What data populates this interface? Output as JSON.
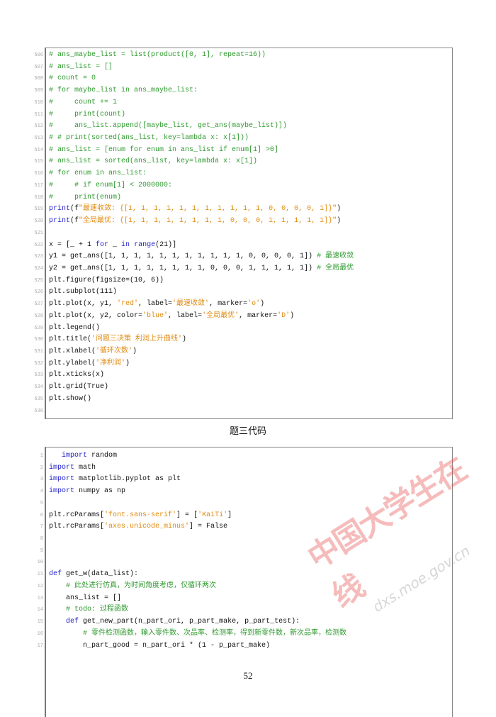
{
  "listing1": [
    {
      "n": "506",
      "t": [
        [
          "c",
          "# ans_maybe_list = list(product([0, 1], repeat=16))"
        ]
      ]
    },
    {
      "n": "507",
      "t": [
        [
          "c",
          "# ans_list = []"
        ]
      ]
    },
    {
      "n": "508",
      "t": [
        [
          "c",
          "# count = 0"
        ]
      ]
    },
    {
      "n": "509",
      "t": [
        [
          "c",
          "# for maybe_list in ans_maybe_list:"
        ]
      ]
    },
    {
      "n": "510",
      "t": [
        [
          "c",
          "#     count += 1"
        ]
      ]
    },
    {
      "n": "511",
      "t": [
        [
          "c",
          "#     print(count)"
        ]
      ]
    },
    {
      "n": "512",
      "t": [
        [
          "c",
          "#     ans_list.append([maybe_list, get_ans(maybe_list)])"
        ]
      ]
    },
    {
      "n": "513",
      "t": [
        [
          "c",
          "# # print(sorted(ans_list, key=lambda x: x[1]))"
        ]
      ]
    },
    {
      "n": "514",
      "t": [
        [
          "c",
          "# ans_list = [enum for enum in ans_list if enum[1] >0]"
        ]
      ]
    },
    {
      "n": "515",
      "t": [
        [
          "c",
          "# ans_list = sorted(ans_list, key=lambda x: x[1])"
        ]
      ]
    },
    {
      "n": "516",
      "t": [
        [
          "c",
          "# for enum in ans_list:"
        ]
      ]
    },
    {
      "n": "517",
      "t": [
        [
          "c",
          "#     # if enum[1] < 2000000:"
        ]
      ]
    },
    {
      "n": "518",
      "t": [
        [
          "c",
          "#     print(enum)"
        ]
      ]
    },
    {
      "n": "519",
      "t": [
        [
          "k",
          "print"
        ],
        [
          "p",
          "(f"
        ],
        [
          "s",
          "\"最速收敛: {[1, 1, 1, 1, 1, 1, 1, 1, 1, 1, 1, 0, 0, 0, 0, 1]}\""
        ],
        [
          "p",
          ")"
        ]
      ]
    },
    {
      "n": "520",
      "t": [
        [
          "k",
          "print"
        ],
        [
          "p",
          "(f"
        ],
        [
          "s",
          "\"全局最优: {[1, 1, 1, 1, 1, 1, 1, 1, 0, 0, 0, 1, 1, 1, 1, 1]}\""
        ],
        [
          "p",
          ")"
        ]
      ]
    },
    {
      "n": "521",
      "t": []
    },
    {
      "n": "522",
      "t": [
        [
          "p",
          "x = [_ + 1 "
        ],
        [
          "k",
          "for"
        ],
        [
          "p",
          " _ "
        ],
        [
          "k",
          "in"
        ],
        [
          "p",
          " "
        ],
        [
          "k",
          "range"
        ],
        [
          "p",
          "(21)]"
        ]
      ]
    },
    {
      "n": "523",
      "t": [
        [
          "p",
          "y1 = get_ans([1, 1, 1, 1, 1, 1, 1, 1, 1, 1, 1, 0, 0, 0, 0, 1]) "
        ],
        [
          "c",
          "# 最速收敛"
        ]
      ]
    },
    {
      "n": "524",
      "t": [
        [
          "p",
          "y2 = get_ans([1, 1, 1, 1, 1, 1, 1, 1, 0, 0, 0, 1, 1, 1, 1, 1]) "
        ],
        [
          "c",
          "# 全局最优"
        ]
      ]
    },
    {
      "n": "525",
      "t": [
        [
          "p",
          "plt.figure(figsize=(10, 6))"
        ]
      ]
    },
    {
      "n": "526",
      "t": [
        [
          "p",
          "plt.subplot(111)"
        ]
      ]
    },
    {
      "n": "527",
      "t": [
        [
          "p",
          "plt.plot(x, y1, "
        ],
        [
          "s",
          "'red'"
        ],
        [
          "p",
          ", label="
        ],
        [
          "s",
          "'最速收敛'"
        ],
        [
          "p",
          ", marker="
        ],
        [
          "s",
          "'o'"
        ],
        [
          "p",
          ")"
        ]
      ]
    },
    {
      "n": "528",
      "t": [
        [
          "p",
          "plt.plot(x, y2, color="
        ],
        [
          "s",
          "'blue'"
        ],
        [
          "p",
          ", label="
        ],
        [
          "s",
          "'全局最优'"
        ],
        [
          "p",
          ", marker="
        ],
        [
          "s",
          "'D'"
        ],
        [
          "p",
          ")"
        ]
      ]
    },
    {
      "n": "529",
      "t": [
        [
          "p",
          "plt.legend()"
        ]
      ]
    },
    {
      "n": "530",
      "t": [
        [
          "p",
          "plt.title("
        ],
        [
          "s",
          "'问题三决策 利润上升曲线'"
        ],
        [
          "p",
          ")"
        ]
      ]
    },
    {
      "n": "531",
      "t": [
        [
          "p",
          "plt.xlabel("
        ],
        [
          "s",
          "'循环次数'"
        ],
        [
          "p",
          ")"
        ]
      ]
    },
    {
      "n": "532",
      "t": [
        [
          "p",
          "plt.ylabel("
        ],
        [
          "s",
          "'净利润'"
        ],
        [
          "p",
          ")"
        ]
      ]
    },
    {
      "n": "533",
      "t": [
        [
          "p",
          "plt.xticks(x)"
        ]
      ]
    },
    {
      "n": "534",
      "t": [
        [
          "p",
          "plt.grid(True)"
        ]
      ]
    },
    {
      "n": "535",
      "t": [
        [
          "p",
          "plt.show()"
        ]
      ]
    },
    {
      "n": "536",
      "t": []
    }
  ],
  "caption": "题三代码",
  "listing2": [
    {
      "n": "1",
      "t": [
        [
          "p",
          "   "
        ],
        [
          "k",
          "import"
        ],
        [
          "p",
          " random"
        ]
      ]
    },
    {
      "n": "2",
      "t": [
        [
          "k",
          "import"
        ],
        [
          "p",
          " math"
        ]
      ]
    },
    {
      "n": "3",
      "t": [
        [
          "k",
          "import"
        ],
        [
          "p",
          " matplotlib.pyplot as plt"
        ]
      ]
    },
    {
      "n": "4",
      "t": [
        [
          "k",
          "import"
        ],
        [
          "p",
          " numpy as np"
        ]
      ]
    },
    {
      "n": "5",
      "t": []
    },
    {
      "n": "6",
      "t": [
        [
          "p",
          "plt.rcParams["
        ],
        [
          "s",
          "'font.sans-serif'"
        ],
        [
          "p",
          "] = ["
        ],
        [
          "s",
          "'KaiTi'"
        ],
        [
          "p",
          "]"
        ]
      ]
    },
    {
      "n": "7",
      "t": [
        [
          "p",
          "plt.rcParams["
        ],
        [
          "s",
          "'axes.unicode_minus'"
        ],
        [
          "p",
          "] = False"
        ]
      ]
    },
    {
      "n": "8",
      "t": []
    },
    {
      "n": "9",
      "t": []
    },
    {
      "n": "10",
      "t": []
    },
    {
      "n": "11",
      "t": [
        [
          "k",
          "def"
        ],
        [
          "p",
          " get_w(data_list):"
        ]
      ]
    },
    {
      "n": "12",
      "t": [
        [
          "p",
          "    "
        ],
        [
          "c",
          "# 此处进行仿真，为时间角度考虑，仅循环两次"
        ]
      ]
    },
    {
      "n": "13",
      "t": [
        [
          "p",
          "    ans_list = []"
        ]
      ]
    },
    {
      "n": "14",
      "t": [
        [
          "p",
          "    "
        ],
        [
          "c",
          "# todo: 过程函数"
        ]
      ]
    },
    {
      "n": "15",
      "t": [
        [
          "p",
          "    "
        ],
        [
          "k",
          "def"
        ],
        [
          "p",
          " get_new_part(n_part_ori, p_part_make, p_part_test):"
        ]
      ]
    },
    {
      "n": "16",
      "t": [
        [
          "p",
          "        "
        ],
        [
          "c",
          "# 零件检测函数，输入零件数、次品率、检测率，得到新零件数，新次品率，检测数"
        ]
      ]
    },
    {
      "n": "17",
      "t": [
        [
          "p",
          "        n_part_good = n_part_ori * (1 - p_part_make)"
        ]
      ]
    }
  ],
  "page_number": "52",
  "watermark": {
    "text": "中国大学生在线",
    "url": "dxs.moe.gov.cn"
  }
}
